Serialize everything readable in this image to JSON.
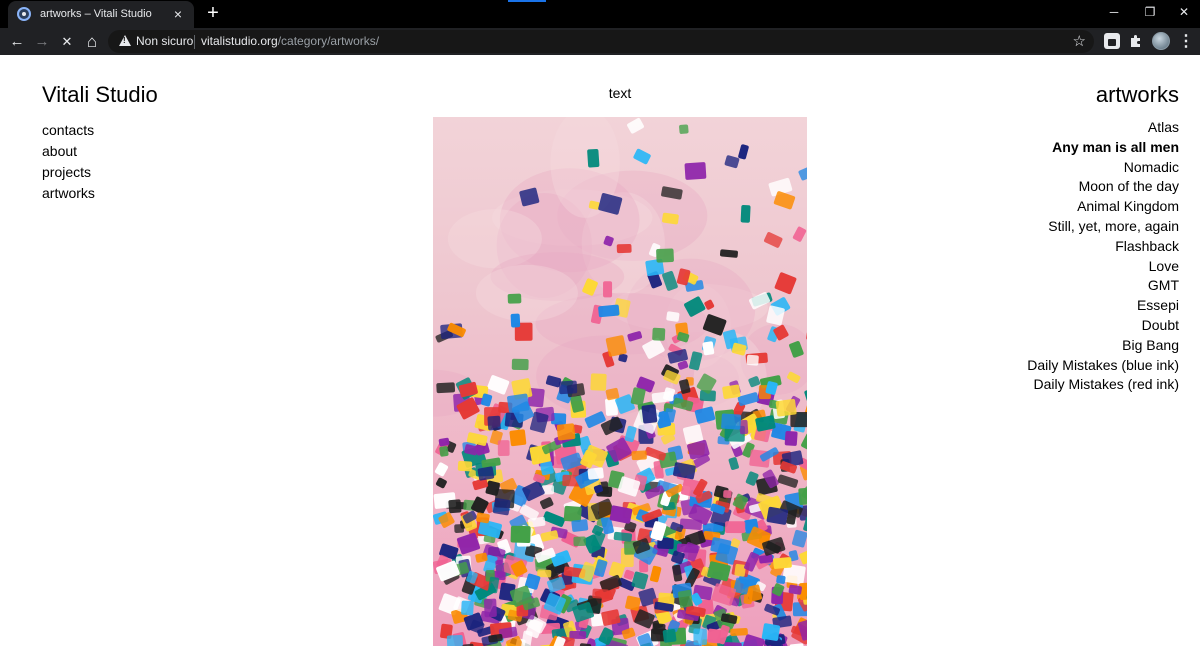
{
  "browser": {
    "tab_title": "artworks – Vitali Studio",
    "security_label": "Non sicuro",
    "url_host": "vitalistudio.org",
    "url_path": "/category/artworks/",
    "icons": {
      "favicon": "site-favicon-icon",
      "close": "×",
      "new_tab": "+",
      "back": "←",
      "forward": "→",
      "stop": "✕",
      "home": "⌂",
      "star": "☆",
      "minimize": "─",
      "restore": "❐",
      "window_close": "✕",
      "menu": "⋮"
    }
  },
  "page": {
    "site_title": "Vitali Studio",
    "nav": [
      "contacts",
      "about",
      "projects",
      "artworks"
    ],
    "center_label": "text",
    "category_heading": "artworks",
    "artworks": [
      {
        "label": "Atlas",
        "current": false
      },
      {
        "label": "Any man is all men",
        "current": true
      },
      {
        "label": "Nomadic",
        "current": false
      },
      {
        "label": "Moon of the day",
        "current": false
      },
      {
        "label": "Animal Kingdom",
        "current": false
      },
      {
        "label": "Still, yet, more, again",
        "current": false
      },
      {
        "label": "Flashback",
        "current": false
      },
      {
        "label": "Love",
        "current": false
      },
      {
        "label": "GMT",
        "current": false
      },
      {
        "label": "Essepi",
        "current": false
      },
      {
        "label": "Doubt",
        "current": false
      },
      {
        "label": "Big Bang",
        "current": false
      },
      {
        "label": "Daily Mistakes (blue ink)",
        "current": false
      },
      {
        "label": "Daily Mistakes (red ink)",
        "current": false
      }
    ]
  },
  "colors": {
    "chrome_dark": "#202124",
    "tab_strip": "#000000",
    "page_background": "#ffffff",
    "text": "#000000",
    "painting_palette": [
      "#e53935",
      "#fb8c00",
      "#fdd835",
      "#43a047",
      "#1e88e5",
      "#29b6f6",
      "#8e24aa",
      "#1a237e",
      "#ffffff",
      "#00897b",
      "#f06292",
      "#212121"
    ]
  }
}
